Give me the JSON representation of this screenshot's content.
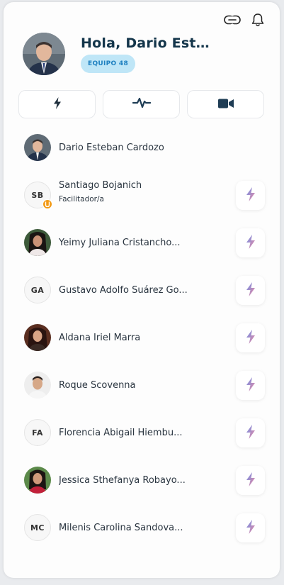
{
  "header": {
    "greeting": "Hola, Dario Este...",
    "team_badge": "EQUIPO 48"
  },
  "icons": {
    "top": [
      "link-icon",
      "bell-icon"
    ],
    "actions": [
      "lightning-icon",
      "activity-icon",
      "video-camera-icon"
    ]
  },
  "members": [
    {
      "name": "Dario Esteban Cardozo",
      "avatar": "photo",
      "zap": false
    },
    {
      "name": "Santiago Bojanich",
      "role": "Facilitador/a",
      "initials": "SB",
      "badge": "U"
    },
    {
      "name": "Yeimy Juliana Cristancho...",
      "avatar": "photo"
    },
    {
      "name": "Gustavo Adolfo Suárez Go...",
      "initials": "GA"
    },
    {
      "name": "Aldana Iriel Marra",
      "avatar": "photo"
    },
    {
      "name": "Roque Scovenna",
      "avatar": "photo"
    },
    {
      "name": "Florencia Abigail Hiembu...",
      "initials": "FA"
    },
    {
      "name": "Jessica Sthefanya Robayo...",
      "avatar": "photo"
    },
    {
      "name": "Milenis Carolina Sandova...",
      "initials": "MC"
    }
  ],
  "colors": {
    "title": "#13354a",
    "badge_bg": "#bfe6f7",
    "badge_text": "#1e80c0",
    "zap_gradient": [
      "#6b8fe8",
      "#f08aa0"
    ],
    "role_badge": "#f29a15"
  }
}
